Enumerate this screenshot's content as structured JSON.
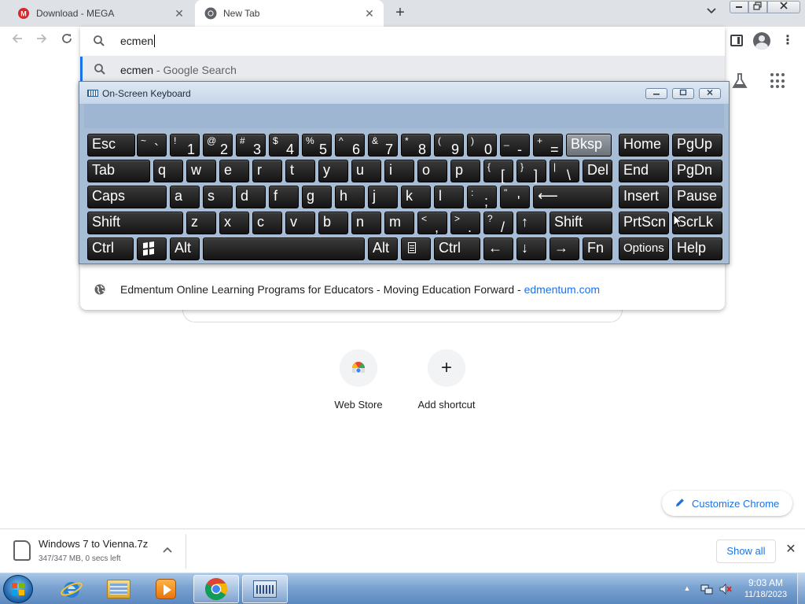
{
  "browser": {
    "tabs": [
      {
        "title": "Download - MEGA",
        "favicon": "mega-icon"
      },
      {
        "title": "New Tab",
        "favicon": "chrome-icon"
      }
    ],
    "new_tab_label": "+",
    "omnibox": {
      "value": "ecmen",
      "suggestions": {
        "google": {
          "query": "ecmen",
          "sub": " - Google Search"
        },
        "site": {
          "title": "Edmentum Online Learning Programs for Educators - Moving Education Forward",
          "sep": " - ",
          "url": "edmentum.com"
        }
      }
    }
  },
  "ntp": {
    "shortcuts": [
      {
        "label": "Web Store"
      },
      {
        "label": "Add shortcut",
        "glyph": "+"
      }
    ],
    "customize_label": "Customize Chrome"
  },
  "downloads": {
    "file_name": "Windows 7 to Vienna.7z",
    "status": "347/347 MB, 0 secs left",
    "show_all": "Show all"
  },
  "osk": {
    "title": "On-Screen Keyboard",
    "rows": [
      [
        {
          "main": "Esc"
        },
        {
          "sup": "~",
          "sub": "`"
        },
        {
          "sup": "!",
          "sub": "1"
        },
        {
          "sup": "@",
          "sub": "2"
        },
        {
          "sup": "#",
          "sub": "3"
        },
        {
          "sup": "$",
          "sub": "4"
        },
        {
          "sup": "%",
          "sub": "5"
        },
        {
          "sup": "^",
          "sub": "6"
        },
        {
          "sup": "&",
          "sub": "7"
        },
        {
          "sup": "*",
          "sub": "8"
        },
        {
          "sup": "(",
          "sub": "9"
        },
        {
          "sup": ")",
          "sub": "0"
        },
        {
          "sup": "_",
          "sub": "-"
        },
        {
          "sup": "+",
          "sub": "="
        },
        {
          "main": "Bksp",
          "hover": true
        },
        {
          "main": "Home"
        },
        {
          "main": "PgUp"
        }
      ],
      [
        {
          "main": "Tab"
        },
        {
          "main": "q"
        },
        {
          "main": "w"
        },
        {
          "main": "e"
        },
        {
          "main": "r"
        },
        {
          "main": "t"
        },
        {
          "main": "y"
        },
        {
          "main": "u"
        },
        {
          "main": "i"
        },
        {
          "main": "o"
        },
        {
          "main": "p"
        },
        {
          "sup": "{",
          "sub": "["
        },
        {
          "sup": "}",
          "sub": "]"
        },
        {
          "sup": "|",
          "sub": "\\"
        },
        {
          "main": "Del"
        },
        {
          "main": "End"
        },
        {
          "main": "PgDn"
        }
      ],
      [
        {
          "main": "Caps"
        },
        {
          "main": "a"
        },
        {
          "main": "s"
        },
        {
          "main": "d"
        },
        {
          "main": "f"
        },
        {
          "main": "g"
        },
        {
          "main": "h"
        },
        {
          "main": "j"
        },
        {
          "main": "k"
        },
        {
          "main": "l"
        },
        {
          "sup": ":",
          "sub": ";"
        },
        {
          "sup": "\"",
          "sub": "'"
        },
        {
          "main": "⟵"
        },
        {
          "main": "Insert"
        },
        {
          "main": "Pause"
        }
      ],
      [
        {
          "main": "Shift"
        },
        {
          "main": "z"
        },
        {
          "main": "x"
        },
        {
          "main": "c"
        },
        {
          "main": "v"
        },
        {
          "main": "b"
        },
        {
          "main": "n"
        },
        {
          "main": "m"
        },
        {
          "sup": "<",
          "sub": ","
        },
        {
          "sup": ">",
          "sub": "."
        },
        {
          "sup": "?",
          "sub": "/"
        },
        {
          "main": "↑"
        },
        {
          "main": "Shift"
        },
        {
          "main": "PrtScn"
        },
        {
          "main": "ScrLk"
        }
      ],
      [
        {
          "main": "Ctrl"
        },
        {
          "icon": "windows-logo-icon"
        },
        {
          "main": "Alt"
        },
        {
          "main": ""
        },
        {
          "main": "Alt"
        },
        {
          "icon": "menu-key-icon"
        },
        {
          "main": "Ctrl"
        },
        {
          "main": "←"
        },
        {
          "main": "↓"
        },
        {
          "main": "→"
        },
        {
          "main": "Fn"
        },
        {
          "main": "Options",
          "small": true
        },
        {
          "main": "Help"
        }
      ]
    ]
  },
  "taskbar": {
    "clock_time": "9:03 AM",
    "clock_date": "11/18/2023"
  },
  "colors": {
    "accent": "#1a73e8",
    "osk_background": "#a7bdd6",
    "taskbar": "#6e98c9"
  }
}
